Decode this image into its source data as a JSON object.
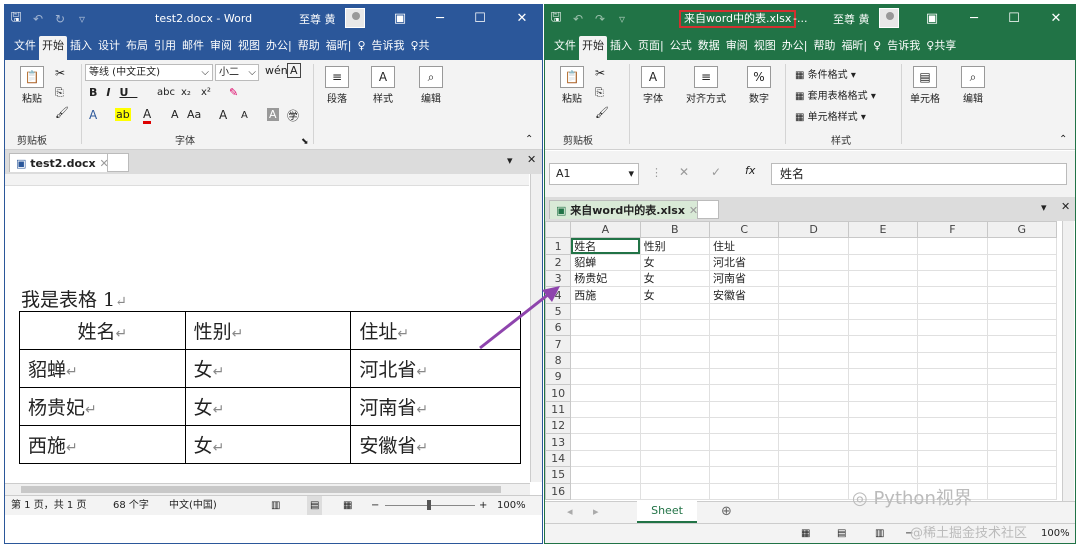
{
  "word": {
    "title": "test2.docx  -  Word",
    "user": "至尊 黄",
    "tabs": [
      "文件",
      "开始",
      "插入",
      "设计",
      "布局",
      "引用",
      "邮件",
      "审阅",
      "视图",
      "办公|",
      "帮助",
      "福昕|",
      "♀",
      "告诉我",
      "♀共"
    ],
    "font_name": "等线 (中文正文)",
    "font_size": "小二",
    "group_clipboard": "剪贴板",
    "group_font": "字体",
    "paste": "粘贴",
    "paragraph": "段落",
    "styles": "样式",
    "editing": "编辑",
    "doc_tab": "test2.docx",
    "caption": "我是表格 1",
    "table": [
      [
        "姓名",
        "性别",
        "住址"
      ],
      [
        "貂蝉",
        "女",
        "河北省"
      ],
      [
        "杨贵妃",
        "女",
        "河南省"
      ],
      [
        "西施",
        "女",
        "安徽省"
      ]
    ],
    "status": {
      "page": "第 1 页，共 1 页",
      "words": "68 个字",
      "lang": "中文(中国)",
      "zoom": "100%"
    }
  },
  "excel": {
    "title": "来自word中的表.xlsx",
    "title_suffix": "-...",
    "user": "至尊 黄",
    "tabs": [
      "文件",
      "开始",
      "插入",
      "页面|",
      "公式",
      "数据",
      "审阅",
      "视图",
      "办公|",
      "帮助",
      "福昕|",
      "♀",
      "告诉我",
      "♀共享"
    ],
    "paste": "粘贴",
    "font": "字体",
    "align": "对齐方式",
    "number": "数字",
    "cond_format": "条件格式 ▾",
    "table_style": "套用表格格式 ▾",
    "cell_style": "单元格样式 ▾",
    "group_styles": "样式",
    "cells": "单元格",
    "editing": "编辑",
    "group_clipboard": "剪贴板",
    "namebox": "A1",
    "formula": "姓名",
    "doc_tab": "来自word中的表.xlsx",
    "cols": [
      "A",
      "B",
      "C",
      "D",
      "E",
      "F",
      "G"
    ],
    "rows": [
      "1",
      "2",
      "3",
      "4",
      "5",
      "6",
      "7",
      "8",
      "9",
      "10",
      "11",
      "12",
      "13",
      "14",
      "15",
      "16"
    ],
    "data": [
      [
        "姓名",
        "性别",
        "住址"
      ],
      [
        "貂蝉",
        "女",
        "河北省"
      ],
      [
        "杨贵妃",
        "女",
        "河南省"
      ],
      [
        "西施",
        "女",
        "安徽省"
      ]
    ],
    "sheet": "Sheet",
    "zoom": "100%"
  },
  "watermark": "Python视界",
  "watermark2": "@稀土掘金技术社区",
  "colors": {
    "word": "#2b579a",
    "excel": "#217346",
    "arrow": "#8e44ad",
    "highlight": "#d32f2f"
  }
}
